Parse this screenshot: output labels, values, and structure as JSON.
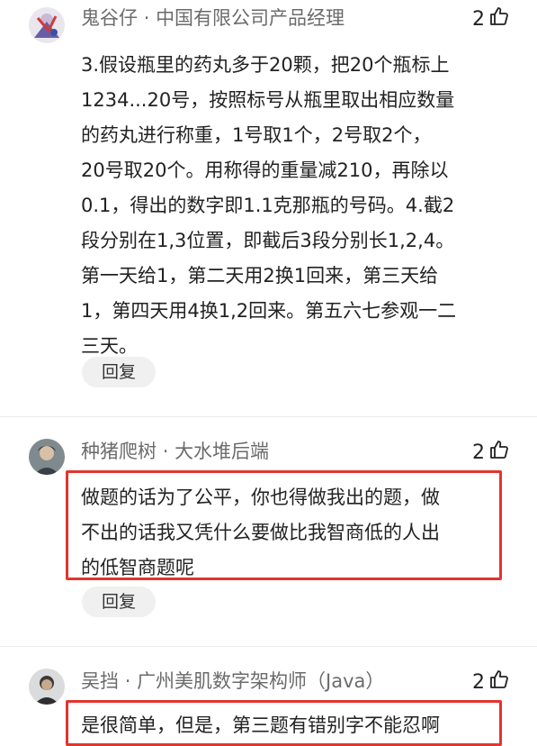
{
  "comments": [
    {
      "author": "鬼谷仔",
      "separator": "·",
      "title": "中国有限公司产品经理",
      "likes": "2",
      "lines": [
        "3.假设瓶里的药丸多于20颗，把20个瓶标上",
        "1234...20号，按照标号从瓶里取出相应数量",
        "的药丸进行称重，1号取1个，2号取2个，",
        "20号取20个。用称得的重量减210，再除以",
        "0.1，得出的数字即1.1克那瓶的号码。4.截2",
        "段分别在1,3位置，即截后3段分别长1,2,4。",
        "第一天给1，第二天用2换1回来，第三天给",
        "1，第四天用4换1,2回来。第五六七参观一二",
        "三天。"
      ],
      "reply_label": "回复"
    },
    {
      "author": "种猪爬树",
      "separator": "·",
      "title": "大水堆后端",
      "likes": "2",
      "lines": [
        "做题的话为了公平，你也得做我出的题，做",
        "不出的话我又凭什么要做比我智商低的人出",
        "的低智商题呢"
      ],
      "reply_label": "回复"
    },
    {
      "author": "吴挡",
      "separator": "·",
      "title": "广州美肌数字架构师（Java）",
      "likes": "2",
      "lines": [
        "是很简单，但是，第三题有错别字不能忍啊"
      ]
    }
  ],
  "colors": {
    "highlight": "#e3342f",
    "meta_text": "#6b6b6b",
    "reply_bg": "#f0f0f0"
  }
}
